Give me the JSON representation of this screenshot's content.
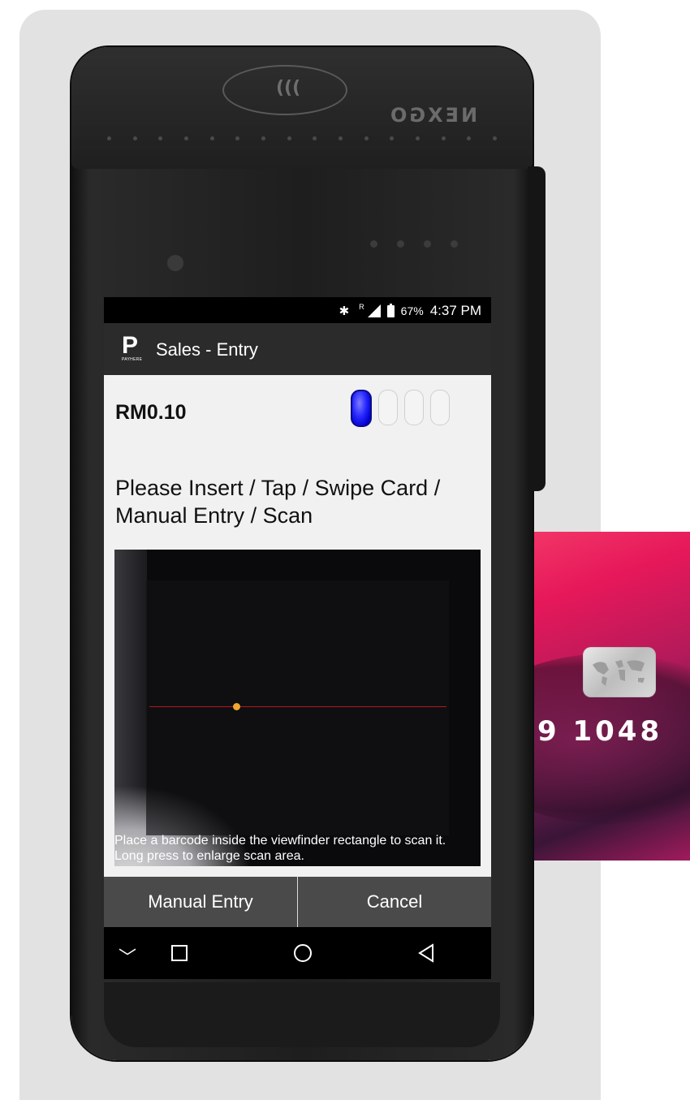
{
  "device": {
    "brand": "NEXGO",
    "contactless_waves": "(((",
    "card_number_fragment": "9 1048"
  },
  "statusbar": {
    "bluetooth": "✱",
    "roaming": "R",
    "battery_percent": "67%",
    "time": "4:37 PM"
  },
  "appbar": {
    "logo_letter": "P",
    "logo_subtext": "PAYHERE",
    "title": "Sales - Entry"
  },
  "main": {
    "amount": "RM0.10",
    "prompt": "Please Insert / Tap / Swipe Card / Manual Entry / Scan",
    "scanner_hint": "Place a barcode inside the viewfinder rectangle to scan it. Long press to enlarge scan area."
  },
  "buttons": {
    "manual_entry": "Manual Entry",
    "cancel": "Cancel"
  },
  "navbar": {
    "hide_keyboard": "﹀"
  },
  "colors": {
    "app_bar": "#2b2b2b",
    "active_indicator": "#2727ff",
    "laser_line": "#b5161a",
    "card_pink": "#e6185a"
  }
}
